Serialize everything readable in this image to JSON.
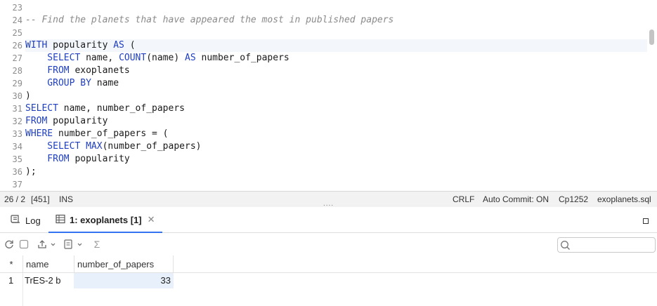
{
  "editor": {
    "lines": [
      {
        "num": "23",
        "parts": []
      },
      {
        "num": "24",
        "parts": [
          {
            "t": "-- Find the planets that have appeared the most in published papers",
            "c": "cm"
          }
        ]
      },
      {
        "num": "25",
        "parts": []
      },
      {
        "num": "26",
        "parts": [
          {
            "t": "WITH",
            "c": "kw"
          },
          {
            "t": " popularity ",
            "c": "txt"
          },
          {
            "t": "AS",
            "c": "kw"
          },
          {
            "t": " (",
            "c": "txt"
          }
        ]
      },
      {
        "num": "27",
        "parts": [
          {
            "t": "    SELECT",
            "c": "kw"
          },
          {
            "t": " name, ",
            "c": "txt"
          },
          {
            "t": "COUNT",
            "c": "fn"
          },
          {
            "t": "(name) ",
            "c": "txt"
          },
          {
            "t": "AS",
            "c": "kw"
          },
          {
            "t": " number_of_papers",
            "c": "txt"
          }
        ]
      },
      {
        "num": "28",
        "parts": [
          {
            "t": "    FROM",
            "c": "kw"
          },
          {
            "t": " exoplanets",
            "c": "txt"
          }
        ]
      },
      {
        "num": "29",
        "parts": [
          {
            "t": "    GROUP BY",
            "c": "kw"
          },
          {
            "t": " name",
            "c": "txt"
          }
        ]
      },
      {
        "num": "30",
        "parts": [
          {
            "t": ")",
            "c": "txt"
          }
        ]
      },
      {
        "num": "31",
        "parts": [
          {
            "t": "SELECT",
            "c": "kw"
          },
          {
            "t": " name, number_of_papers",
            "c": "txt"
          }
        ]
      },
      {
        "num": "32",
        "parts": [
          {
            "t": "FROM",
            "c": "kw"
          },
          {
            "t": " popularity",
            "c": "txt"
          }
        ]
      },
      {
        "num": "33",
        "parts": [
          {
            "t": "WHERE",
            "c": "kw"
          },
          {
            "t": " number_of_papers = (",
            "c": "txt"
          }
        ]
      },
      {
        "num": "34",
        "parts": [
          {
            "t": "    SELECT",
            "c": "kw"
          },
          {
            "t": " ",
            "c": "txt"
          },
          {
            "t": "MAX",
            "c": "fn"
          },
          {
            "t": "(number_of_papers)",
            "c": "txt"
          }
        ]
      },
      {
        "num": "35",
        "parts": [
          {
            "t": "    FROM",
            "c": "kw"
          },
          {
            "t": " popularity",
            "c": "txt"
          }
        ]
      },
      {
        "num": "36",
        "parts": [
          {
            "t": ");",
            "c": "txt"
          }
        ]
      },
      {
        "num": "37",
        "parts": []
      }
    ]
  },
  "status": {
    "position": "26 / 2",
    "chars": "[451]",
    "mode": "INS",
    "line_ending": "CRLF",
    "auto_commit": "Auto Commit: ON",
    "encoding": "Cp1252",
    "file": "exoplanets.sql"
  },
  "splitter": "....",
  "tabs": {
    "log_label": "Log",
    "result_label": "1: exoplanets [1]"
  },
  "icons": {
    "log": "log-icon",
    "table": "table-icon",
    "close": "close-icon",
    "refresh": "refresh-icon",
    "stop": "stop-icon",
    "export": "export-icon",
    "import": "import-icon",
    "sum": "sum-icon",
    "search": "search-icon",
    "maximize": "maximize-icon"
  },
  "toolbar": {
    "sum_glyph": "Σ"
  },
  "grid": {
    "corner": "*",
    "columns": [
      "name",
      "number_of_papers"
    ],
    "rows": [
      {
        "num": "1",
        "name": "TrES-2 b",
        "number_of_papers": "33"
      }
    ]
  },
  "colors": {
    "keyword": "#1f3fbf",
    "comment": "#8a8a8a",
    "active_tab": "#3574f0",
    "selection": "#e8f0fb"
  }
}
